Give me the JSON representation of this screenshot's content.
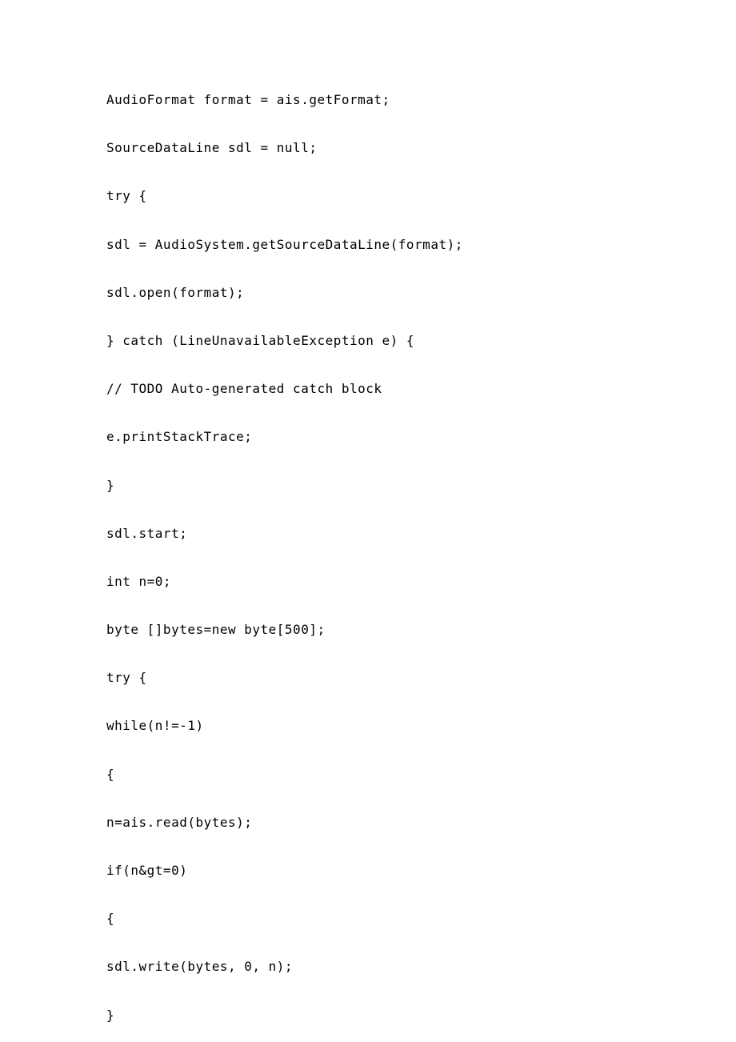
{
  "lines": [
    "AudioFormat format = ais.getFormat;",
    "SourceDataLine sdl = null;",
    "try {",
    "sdl = AudioSystem.getSourceDataLine(format);",
    "sdl.open(format);",
    "} catch (LineUnavailableException e) {",
    "// TODO Auto-generated catch block",
    "e.printStackTrace;",
    "}",
    "sdl.start;",
    "int n=0;",
    "byte []bytes=new byte[500];",
    "try {",
    "while(n!=-1)",
    "{",
    "n=ais.read(bytes);",
    "if(n&gt=0)",
    "{",
    "sdl.write(bytes, 0, n);",
    "}"
  ]
}
